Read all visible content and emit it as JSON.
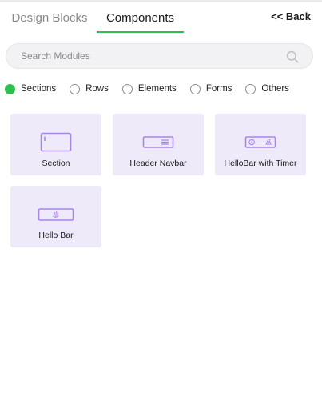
{
  "tabs": [
    {
      "label": "Design Blocks",
      "active": false
    },
    {
      "label": "Components",
      "active": true
    }
  ],
  "back": {
    "label": "<< Back"
  },
  "search": {
    "placeholder": "Search Modules",
    "value": ""
  },
  "filters": [
    {
      "label": "Sections",
      "checked": true
    },
    {
      "label": "Rows",
      "checked": false
    },
    {
      "label": "Elements",
      "checked": false
    },
    {
      "label": "Forms",
      "checked": false
    },
    {
      "label": "Others",
      "checked": false
    }
  ],
  "modules": [
    {
      "label": "Section",
      "icon": "section-icon"
    },
    {
      "label": "Header Navbar",
      "icon": "header-navbar-icon"
    },
    {
      "label": "HelloBar with Timer",
      "icon": "hellobar-timer-icon"
    },
    {
      "label": "Hello Bar",
      "icon": "hello-bar-icon"
    }
  ],
  "colors": {
    "accent": "#2ebf4f",
    "card_bg": "#efeafa",
    "icon_stroke": "#a985e8"
  }
}
